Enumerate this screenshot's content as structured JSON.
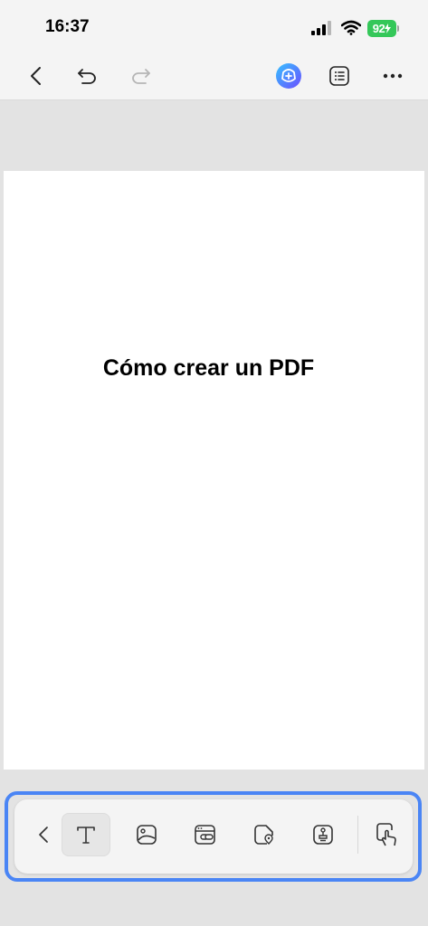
{
  "status_bar": {
    "time": "16:37",
    "battery_level": "92"
  },
  "toolbar": {
    "icons": [
      "chevron-left-icon",
      "undo-icon",
      "redo-icon",
      "ai-assistant-icon",
      "outline-list-icon",
      "more-icon"
    ]
  },
  "document": {
    "title": "Cómo crear un PDF"
  },
  "bottom_toolbar": {
    "active_tool": "text",
    "tools": [
      "chevron-left-icon",
      "text-tool-icon",
      "image-tool-icon",
      "link-tool-icon",
      "location-tool-icon",
      "stamp-tool-icon",
      "touch-select-icon"
    ]
  },
  "colors": {
    "highlight": "#4a85f5",
    "battery": "#34c759",
    "ai_gradient_start": "#35c2ff",
    "ai_gradient_end": "#6b4dff"
  }
}
